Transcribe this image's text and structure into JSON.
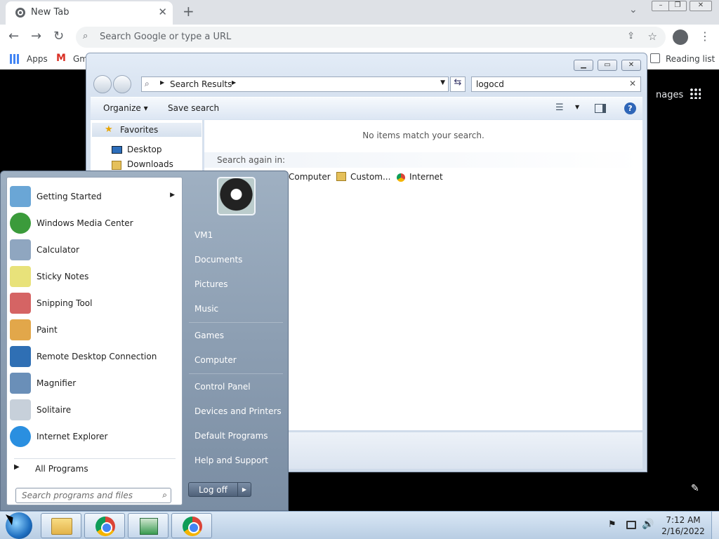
{
  "chrome": {
    "tab_title": "New Tab",
    "omnibox_placeholder": "Search Google or type a URL",
    "bookmarks": {
      "apps": "Apps",
      "gmail": "Gm",
      "reading_list": "Reading list"
    },
    "images_partial": "nages"
  },
  "explorer": {
    "breadcrumb": "Search Results",
    "search_value": "logocd",
    "organize": "Organize",
    "save_search": "Save search",
    "nav": {
      "favorites": "Favorites",
      "desktop": "Desktop",
      "downloads": "Downloads"
    },
    "no_items": "No items match your search.",
    "search_again_label": "Search again in:",
    "search_again": [
      "Computer",
      "Custom...",
      "Internet"
    ]
  },
  "start_menu": {
    "programs": [
      {
        "label": "Getting Started",
        "icon": "getting-started-icon",
        "color": "#6aa6d6"
      },
      {
        "label": "Windows Media Center",
        "icon": "media-center-icon",
        "color": "#3b9b3b"
      },
      {
        "label": "Calculator",
        "icon": "calculator-icon",
        "color": "#8fa6c0"
      },
      {
        "label": "Sticky Notes",
        "icon": "sticky-notes-icon",
        "color": "#e8e27a"
      },
      {
        "label": "Snipping Tool",
        "icon": "snipping-tool-icon",
        "color": "#d56464"
      },
      {
        "label": "Paint",
        "icon": "paint-icon",
        "color": "#e2a74a"
      },
      {
        "label": "Remote Desktop Connection",
        "icon": "remote-desktop-icon",
        "color": "#2f6fb4"
      },
      {
        "label": "Magnifier",
        "icon": "magnifier-icon",
        "color": "#6a8fb8"
      },
      {
        "label": "Solitaire",
        "icon": "solitaire-icon",
        "color": "#c7d0da"
      },
      {
        "label": "Internet Explorer",
        "icon": "internet-explorer-icon",
        "color": "#2a8fe0"
      }
    ],
    "all_programs": "All Programs",
    "search_placeholder": "Search programs and files",
    "right_links": [
      "VM1",
      "Documents",
      "Pictures",
      "Music",
      "Games",
      "Computer",
      "Control Panel",
      "Devices and Printers",
      "Default Programs",
      "Help and Support"
    ],
    "log_off": "Log off"
  },
  "taskbar": {
    "time": "7:12 AM",
    "date": "2/16/2022"
  }
}
